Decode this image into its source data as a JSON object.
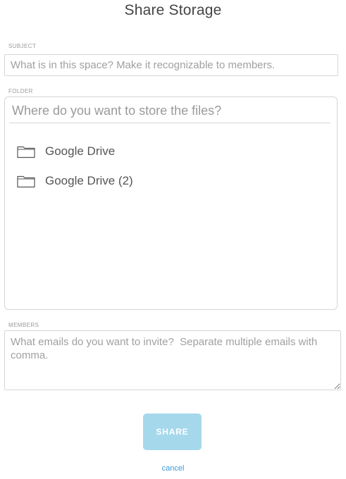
{
  "dialog": {
    "title": "Share Storage"
  },
  "subject": {
    "label": "SUBJECT",
    "placeholder": "What is in this space? Make it recognizable to members.",
    "value": ""
  },
  "folder": {
    "label": "FOLDER",
    "search_placeholder": "Where do you want to store the files?",
    "search_value": "",
    "items": [
      {
        "name": "Google Drive",
        "icon": "folder-icon"
      },
      {
        "name": "Google Drive (2)",
        "icon": "folder-icon"
      }
    ]
  },
  "members": {
    "label": "MEMBERS",
    "placeholder": "What emails do you want to invite?  Separate multiple emails with comma.",
    "value": ""
  },
  "actions": {
    "share_label": "SHARE",
    "cancel_label": "cancel"
  },
  "colors": {
    "share_button_bg": "#a6d8ec",
    "cancel_link": "#3a9ad9",
    "border": "#d6d6d6"
  }
}
